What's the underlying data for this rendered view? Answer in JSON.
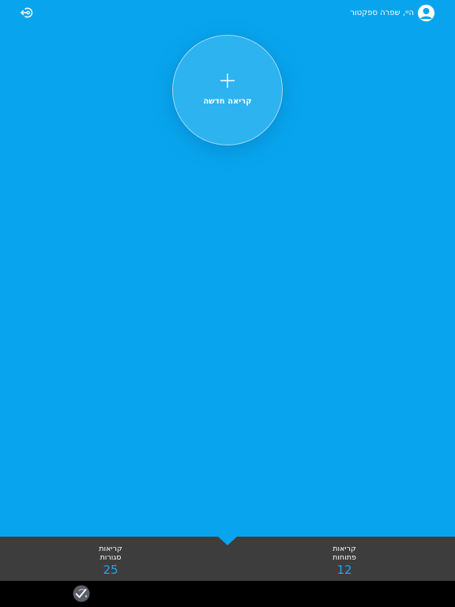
{
  "header": {
    "greeting": "היי, שפרה ספקטור",
    "avatar_icon": "user-avatar-icon",
    "logout_icon": "logout-icon"
  },
  "main": {
    "new_ticket_label": "קריאה חדשה",
    "new_ticket_icon": "plus-icon",
    "background_color": "#08a5ee"
  },
  "stats": {
    "open": {
      "label_line1": "קריאות",
      "label_line2": "פתוחות",
      "count": "12"
    },
    "closed": {
      "label_line1": "קריאות",
      "label_line2": "סגורות",
      "count": "25"
    },
    "bar_color": "#3d3d3d",
    "count_color": "#1ea7e8"
  },
  "footer": {
    "logo_icon": "brand-logo-icon"
  }
}
